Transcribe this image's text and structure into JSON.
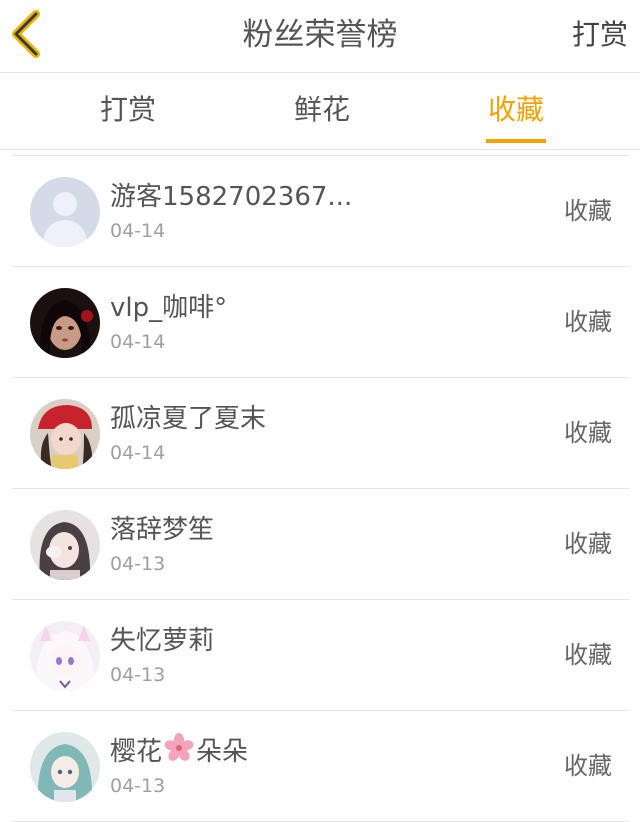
{
  "header": {
    "title": "粉丝荣誉榜",
    "action_label": "打赏"
  },
  "colors": {
    "accent": "#f5a100",
    "text": "#555555",
    "muted": "#a0a0a0",
    "divider": "#e6e6e6"
  },
  "tabs": [
    {
      "label": "打赏",
      "active": false
    },
    {
      "label": "鲜花",
      "active": false
    },
    {
      "label": "收藏",
      "active": true
    }
  ],
  "fans": [
    {
      "name": "游客1582702367...",
      "date": "04-14",
      "type": "收藏",
      "avatar": "default-avatar"
    },
    {
      "name": "vlp_咖啡°",
      "date": "04-14",
      "type": "收藏",
      "avatar": "user-avatar"
    },
    {
      "name": "孤凉夏了夏末",
      "date": "04-14",
      "type": "收藏",
      "avatar": "user-avatar"
    },
    {
      "name": "落辞梦笙",
      "date": "04-13",
      "type": "收藏",
      "avatar": "user-avatar"
    },
    {
      "name": "失忆萝莉",
      "date": "04-13",
      "type": "收藏",
      "avatar": "user-avatar"
    },
    {
      "name_prefix": "樱花",
      "name_suffix": "朵朵",
      "date": "04-13",
      "type": "收藏",
      "avatar": "user-avatar",
      "name_icon": "sakura-flower-icon"
    }
  ]
}
